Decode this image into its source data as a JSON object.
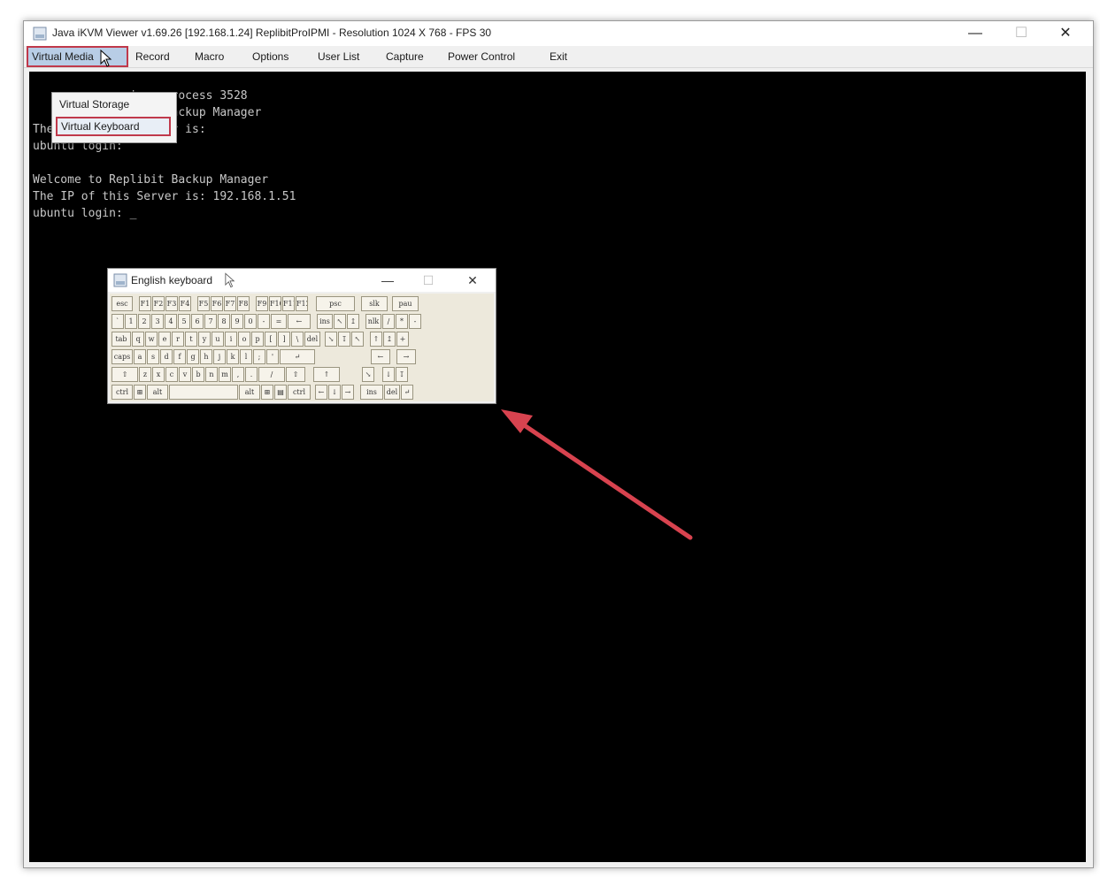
{
  "window": {
    "title": "Java iKVM Viewer v1.69.26 [192.168.1.24] ReplibitProIPMI - Resolution 1024 X 768 - FPS 30",
    "controls": {
      "minimize": "—",
      "maximize": "☐",
      "close": "✕"
    }
  },
  "menubar": {
    "items": [
      {
        "label": "Virtual Media",
        "active": true
      },
      {
        "label": "Record"
      },
      {
        "label": "Macro"
      },
      {
        "label": "Options"
      },
      {
        "label": "User List"
      },
      {
        "label": "Capture"
      },
      {
        "label": "Power Control"
      },
      {
        "label": "Exit"
      }
    ]
  },
  "dropdown": {
    "items": [
      {
        "label": "Virtual Storage"
      },
      {
        "label": "Virtual Keyboard",
        "highlighted": true
      }
    ]
  },
  "console": {
    "lines": [
      "              ing, process 3528",
      "              ibit Backup Manager",
      "The IP of this Server is:",
      "ubuntu login:",
      "",
      "Welcome to Replibit Backup Manager",
      "The IP of this Server is: 192.168.1.51",
      "ubuntu login: _"
    ]
  },
  "keyboard": {
    "title": "English keyboard",
    "controls": {
      "minimize": "—",
      "maximize": "☐",
      "close": "✕"
    },
    "rows": [
      [
        "esc",
        "F1",
        "F2",
        "F3",
        "F4",
        "F5",
        "F6",
        "F7",
        "F8",
        "F9",
        "F10",
        "F11",
        "F12",
        "psc",
        "slk",
        "pau"
      ],
      [
        "`",
        "1",
        "2",
        "3",
        "4",
        "5",
        "6",
        "7",
        "8",
        "9",
        "0",
        "-",
        "=",
        "←",
        "ins",
        "↖",
        "↥",
        "nlk",
        "/",
        "*",
        "-"
      ],
      [
        "tab",
        "q",
        "w",
        "e",
        "r",
        "t",
        "y",
        "u",
        "i",
        "o",
        "p",
        "[",
        "]",
        "\\",
        "del",
        "↘",
        "↧",
        "↖",
        "↑",
        "↥",
        "+"
      ],
      [
        "caps",
        "a",
        "s",
        "d",
        "f",
        "g",
        "h",
        "j",
        "k",
        "l",
        ";",
        "'",
        "↵",
        "←",
        "→"
      ],
      [
        "⇧",
        "z",
        "x",
        "c",
        "v",
        "b",
        "n",
        "m",
        ",",
        ".",
        "/",
        "⇧",
        "↑",
        "↘",
        "↓",
        "↧"
      ],
      [
        "ctrl",
        "⊞",
        "alt",
        "",
        "alt",
        "⊞",
        "▤",
        "ctrl",
        "←",
        "↓",
        "→",
        "ins",
        "del",
        "↵"
      ]
    ]
  },
  "colors": {
    "highlight_border": "#c0394b",
    "annotation_arrow": "#d8434f",
    "console_bg": "#000000",
    "console_text": "#c8c8c8"
  }
}
